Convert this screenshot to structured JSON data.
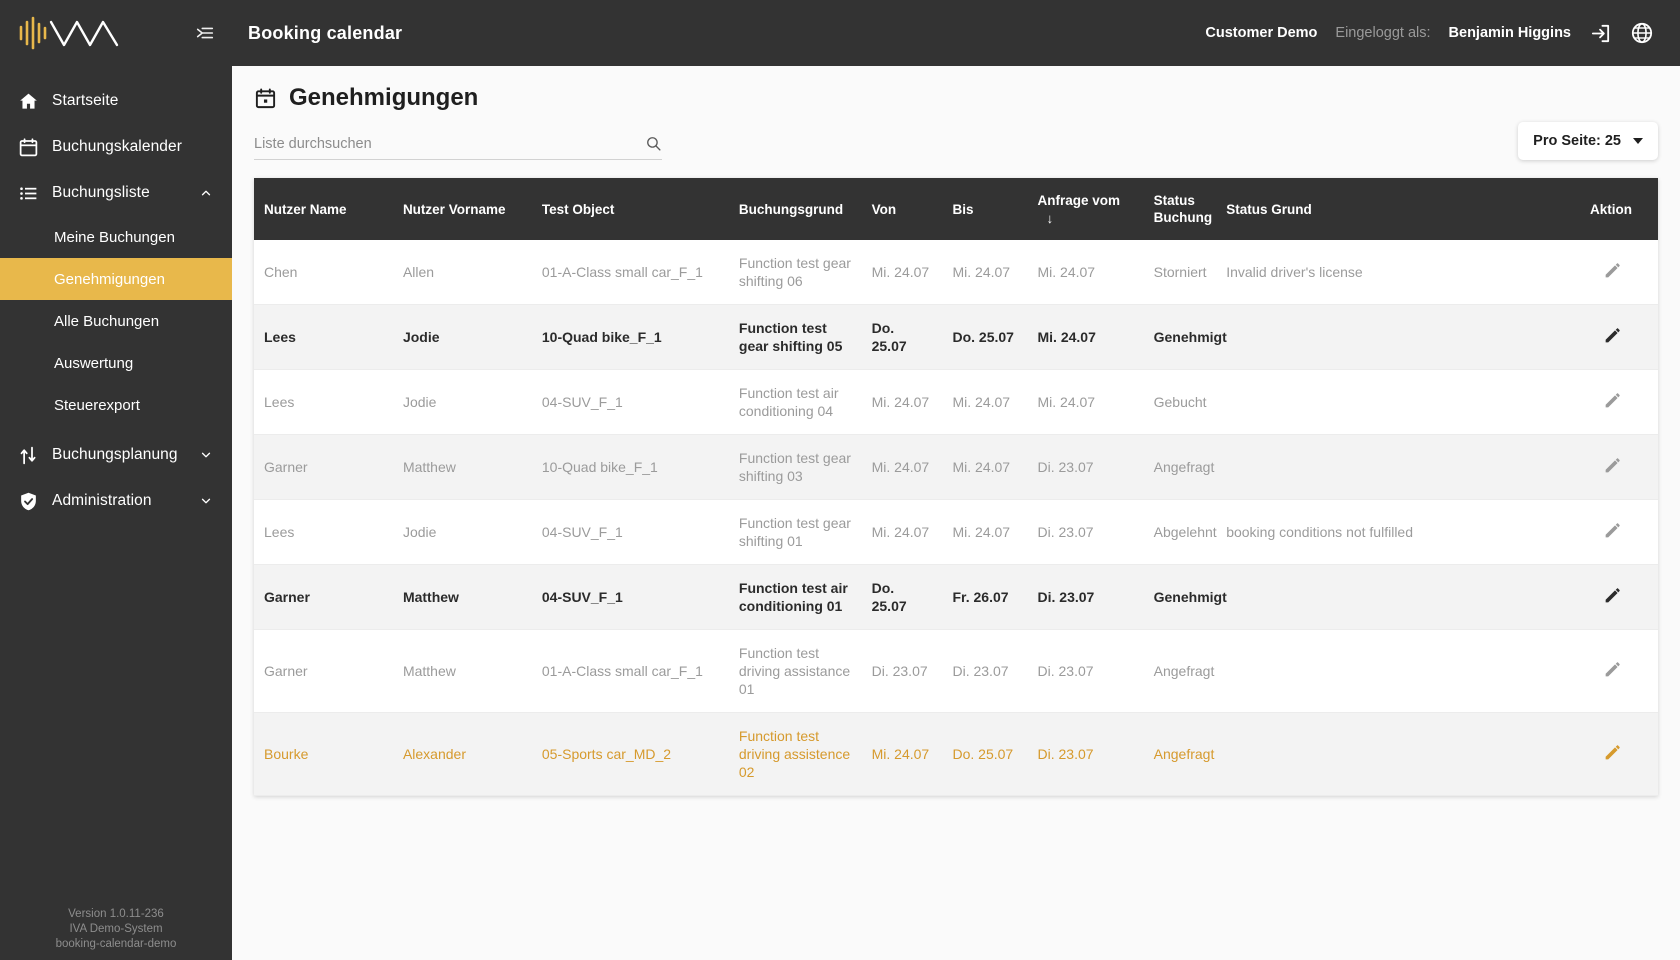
{
  "sidebar": {
    "logo_name": "iva-logo",
    "collapse_icon": "collapse-sidebar-icon",
    "items": [
      {
        "label": "Startseite",
        "icon": "home-icon",
        "expandable": false
      },
      {
        "label": "Buchungskalender",
        "icon": "calendar-icon",
        "expandable": false
      },
      {
        "label": "Buchungsliste",
        "icon": "list-icon",
        "expandable": true,
        "expanded": true
      },
      {
        "label": "Buchungsplanung",
        "icon": "swap-icon",
        "expandable": true,
        "expanded": false
      },
      {
        "label": "Administration",
        "icon": "shield-check-icon",
        "expandable": true,
        "expanded": false
      }
    ],
    "subitems": [
      {
        "label": "Meine Buchungen",
        "active": false
      },
      {
        "label": "Genehmigungen",
        "active": true
      },
      {
        "label": "Alle Buchungen",
        "active": false
      },
      {
        "label": "Auswertung",
        "active": false
      },
      {
        "label": "Steuerexport",
        "active": false
      }
    ],
    "footer": {
      "version": "Version 1.0.11-236",
      "system": "IVA Demo-System",
      "instance": "booking-calendar-demo"
    }
  },
  "topbar": {
    "app_title": "Booking calendar",
    "customer": "Customer Demo",
    "logged_in_label": "Eingeloggt als:",
    "user_name": "Benjamin Higgins",
    "logout_icon": "logout-icon",
    "language_icon": "globe-icon"
  },
  "page": {
    "title": "Genehmigungen",
    "title_icon": "calendar-event-icon",
    "search_placeholder": "Liste durchsuchen",
    "search_value": "",
    "search_icon": "search-icon",
    "per_page_label": "Pro Seite: 25"
  },
  "table": {
    "columns": [
      {
        "label": "Nutzer Name",
        "sorted": false
      },
      {
        "label": "Nutzer Vorname",
        "sorted": false
      },
      {
        "label": "Test Object",
        "sorted": false
      },
      {
        "label": "Buchungsgrund",
        "sorted": false
      },
      {
        "label": "Von",
        "sorted": false
      },
      {
        "label": "Bis",
        "sorted": false
      },
      {
        "label": "Anfrage vom",
        "sorted": true,
        "sort_dir": "↓"
      },
      {
        "label": "Status Buchung",
        "sorted": false
      },
      {
        "label": "Status Grund",
        "sorted": false
      },
      {
        "label": "Aktion",
        "sorted": false
      }
    ],
    "action_icon": "pencil-icon",
    "rows": [
      {
        "nutzer_name": "Chen",
        "nutzer_vorname": "Allen",
        "test_object": "01-A-Class small car_F_1",
        "buchungsgrund": "Function test gear shifting 06",
        "von": "Mi. 24.07",
        "bis": "Mi. 24.07",
        "anfrage_vom": "Mi. 24.07",
        "status_buchung": "Storniert",
        "status_grund": "Invalid driver's license",
        "style": "normal"
      },
      {
        "nutzer_name": "Lees",
        "nutzer_vorname": "Jodie",
        "test_object": "10-Quad bike_F_1",
        "buchungsgrund": "Function test gear shifting 05",
        "von": "Do. 25.07",
        "bis": "Do. 25.07",
        "anfrage_vom": "Mi. 24.07",
        "status_buchung": "Genehmigt",
        "status_grund": "",
        "style": "bold"
      },
      {
        "nutzer_name": "Lees",
        "nutzer_vorname": "Jodie",
        "test_object": "04-SUV_F_1",
        "buchungsgrund": "Function test air conditioning 04",
        "von": "Mi. 24.07",
        "bis": "Mi. 24.07",
        "anfrage_vom": "Mi. 24.07",
        "status_buchung": "Gebucht",
        "status_grund": "",
        "style": "normal"
      },
      {
        "nutzer_name": "Garner",
        "nutzer_vorname": "Matthew",
        "test_object": "10-Quad bike_F_1",
        "buchungsgrund": "Function test gear shifting 03",
        "von": "Mi. 24.07",
        "bis": "Mi. 24.07",
        "anfrage_vom": "Di. 23.07",
        "status_buchung": "Angefragt",
        "status_grund": "",
        "style": "normal"
      },
      {
        "nutzer_name": "Lees",
        "nutzer_vorname": "Jodie",
        "test_object": "04-SUV_F_1",
        "buchungsgrund": "Function test gear shifting 01",
        "von": "Mi. 24.07",
        "bis": "Mi. 24.07",
        "anfrage_vom": "Di. 23.07",
        "status_buchung": "Abgelehnt",
        "status_grund": "booking conditions not fulfilled",
        "style": "normal"
      },
      {
        "nutzer_name": "Garner",
        "nutzer_vorname": "Matthew",
        "test_object": "04-SUV_F_1",
        "buchungsgrund": "Function test air conditioning 01",
        "von": "Do. 25.07",
        "bis": "Fr. 26.07",
        "anfrage_vom": "Di. 23.07",
        "status_buchung": "Genehmigt",
        "status_grund": "",
        "style": "bold"
      },
      {
        "nutzer_name": "Garner",
        "nutzer_vorname": "Matthew",
        "test_object": "01-A-Class small car_F_1",
        "buchungsgrund": "Function test driving assistance 01",
        "von": "Di. 23.07",
        "bis": "Di. 23.07",
        "anfrage_vom": "Di. 23.07",
        "status_buchung": "Angefragt",
        "status_grund": "",
        "style": "normal"
      },
      {
        "nutzer_name": "Bourke",
        "nutzer_vorname": "Alexander",
        "test_object": "05-Sports car_MD_2",
        "buchungsgrund": "Function test driving assistence 02",
        "von": "Mi. 24.07",
        "bis": "Do. 25.07",
        "anfrage_vom": "Di. 23.07",
        "status_buchung": "Angefragt",
        "status_grund": "",
        "style": "accent"
      }
    ]
  },
  "colors": {
    "sidebar_bg": "#333333",
    "accent": "#e8b84b",
    "accent_text": "#d69a2d",
    "content_bg": "#fafafa",
    "row_alt": "#f3f3f3"
  }
}
